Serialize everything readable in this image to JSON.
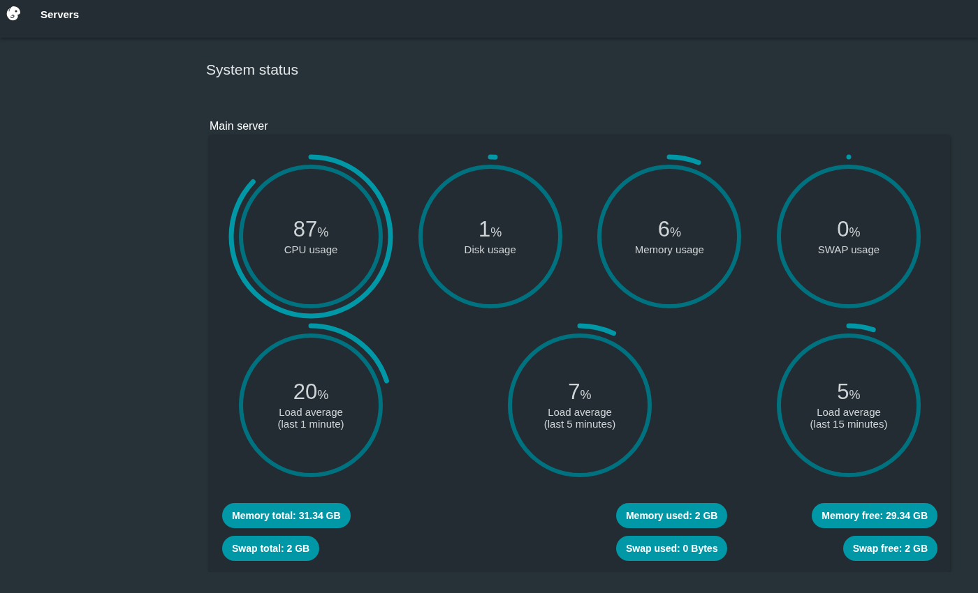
{
  "header": {
    "title": "Servers"
  },
  "page": {
    "title": "System status"
  },
  "server": {
    "name": "Main server",
    "gauge_rows": [
      [
        {
          "value": "87",
          "unit": "%",
          "label": "CPU usage",
          "level": 0.87
        },
        {
          "value": "1",
          "unit": "%",
          "label": "Disk usage",
          "level": 0.01
        },
        {
          "value": "6",
          "unit": "%",
          "label": "Memory usage",
          "level": 0.06
        },
        {
          "value": "0",
          "unit": "%",
          "label": "SWAP usage",
          "level": 0
        }
      ],
      [
        {
          "value": "20",
          "unit": "%",
          "label": "Load average",
          "detail": "(last 1 minute)",
          "level": 0.2
        },
        {
          "value": "7",
          "unit": "%",
          "label": "Load average",
          "detail": "(last 5 minutes)",
          "level": 0.07
        },
        {
          "value": "5",
          "unit": "%",
          "label": "Load average",
          "detail": "(last 15 minutes)",
          "level": 0.05
        }
      ]
    ],
    "chip_columns": [
      [
        "Memory total: 31.34 GB",
        "Swap total: 2 GB"
      ],
      [
        "Memory used: 2 GB",
        "Swap used: 0 Bytes"
      ],
      [
        "Memory free: 29.34 GB",
        "Swap free: 2 GB"
      ]
    ]
  }
}
